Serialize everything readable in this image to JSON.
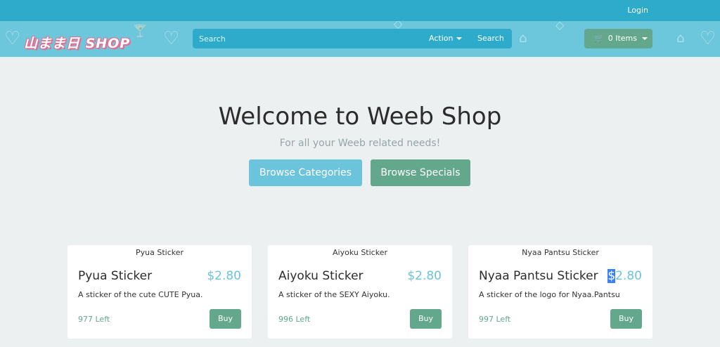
{
  "topbar": {
    "login": "Login"
  },
  "header": {
    "logo_text": "山まま日 SHOP",
    "search": {
      "placeholder": "Search"
    },
    "action_label": "Action",
    "search_label": "Search",
    "cart_label": "0 Items"
  },
  "hero": {
    "title": "Welcome to Weeb Shop",
    "subtitle": "For all your Weeb related needs!",
    "browse_categories": "Browse Categories",
    "browse_specials": "Browse Specials"
  },
  "products": [
    {
      "header": "Pyua Sticker",
      "name": "Pyua Sticker",
      "price": "$2.80",
      "description": "A sticker of the cute CUTE Pyua.",
      "stock": "977 Left",
      "buy": "Buy"
    },
    {
      "header": "Aiyoku Sticker",
      "name": "Aiyoku Sticker",
      "price": "$2.80",
      "description": "A sticker of the SEXY Aiyoku.",
      "stock": "996 Left",
      "buy": "Buy"
    },
    {
      "header": "Nyaa Pantsu Sticker",
      "name": "Nyaa Pantsu Sticker",
      "price_symbol": "$",
      "price_number": "2.80",
      "description": "A sticker of the logo for Nyaa.Pantsu",
      "stock": "997 Left",
      "buy": "Buy"
    }
  ],
  "colors": {
    "topbar": "#2eabca",
    "header": "#6cc7dd",
    "accent_blue": "#6cc3dc",
    "accent_green": "#63a88d",
    "background": "#ecf0f1"
  },
  "icons": [
    "cart-icon",
    "caret-down-icon",
    "heart-doodle-icon",
    "teapot-doodle-icon",
    "cocktail-doodle-icon"
  ]
}
